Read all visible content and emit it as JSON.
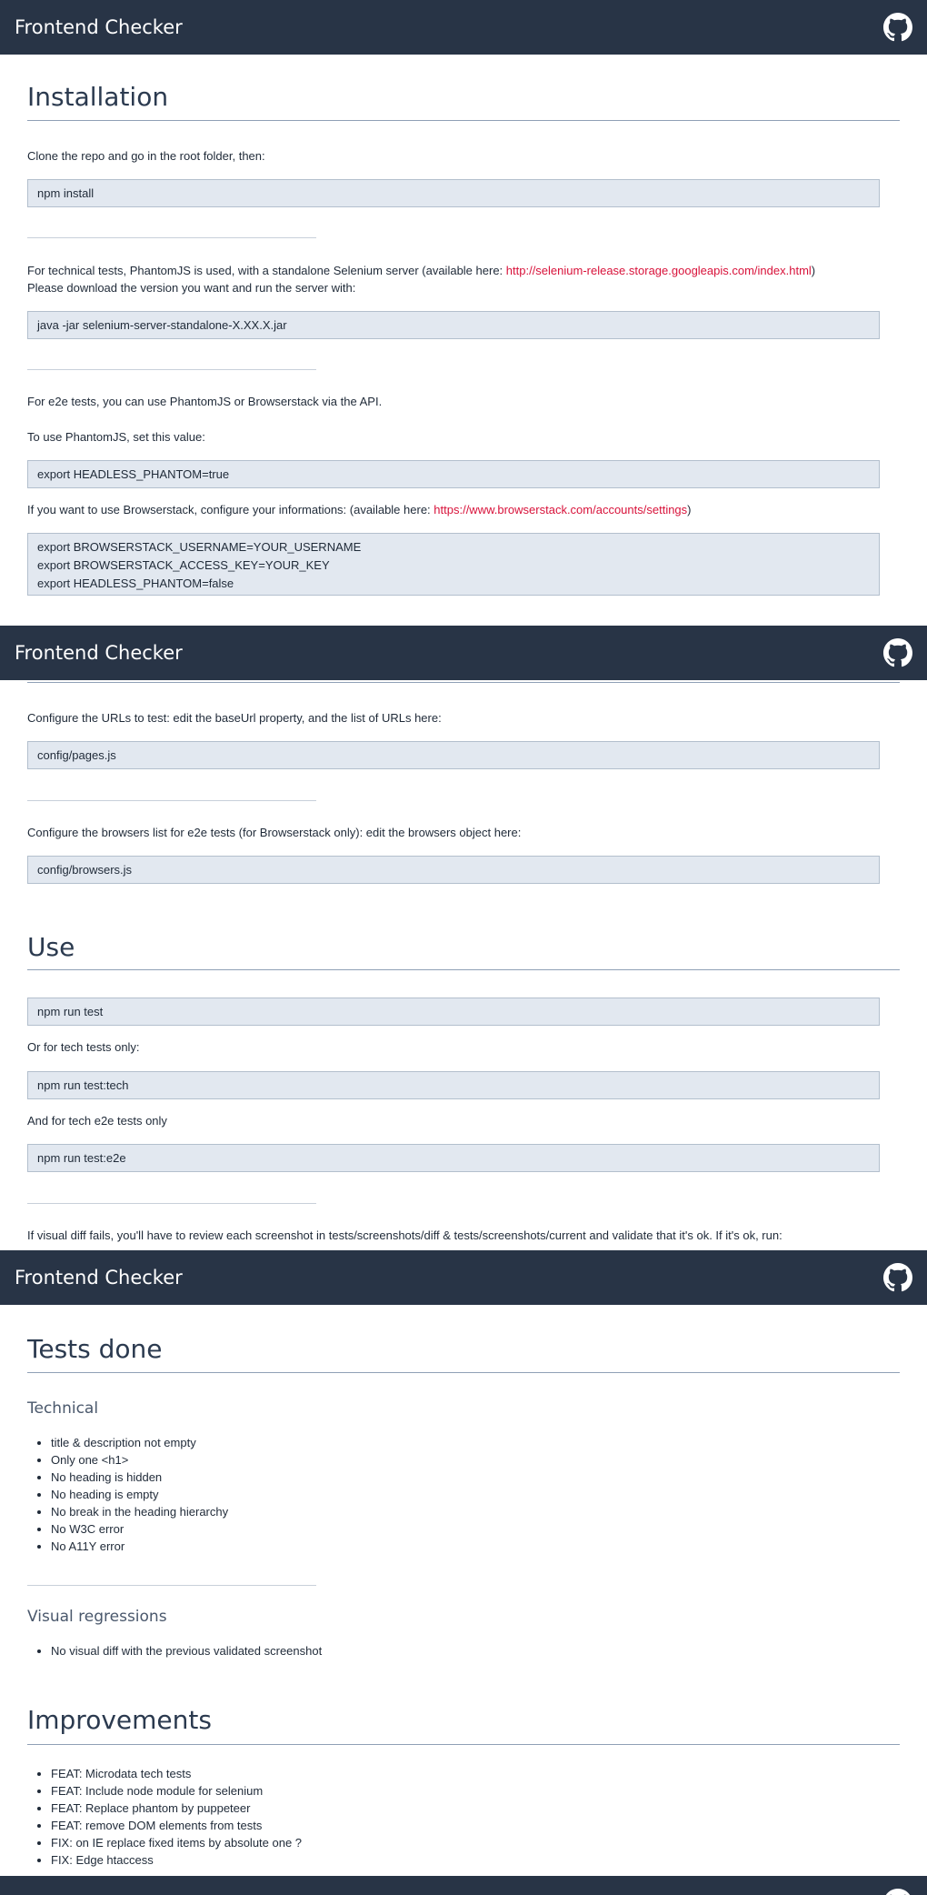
{
  "app": {
    "title": "Frontend Checker",
    "github_icon": "github-icon"
  },
  "installation": {
    "heading": "Installation",
    "clone_text": "Clone the repo and go in the root folder, then:",
    "npm_install": "npm install",
    "tech_text_before": "For technical tests, PhantomJS is used, with a standalone Selenium server (available here: ",
    "selenium_link": "http://selenium-release.storage.googleapis.com/index.html",
    "tech_text_after": ")",
    "download_text": "Please download the version you want and run the server with:",
    "java_cmd": "java -jar selenium-server-standalone-X.XX.X.jar",
    "e2e_text": "For e2e tests, you can use PhantomJS or Browserstack via the API.",
    "phantom_text": "To use PhantomJS, set this value:",
    "phantom_cmd": "export HEADLESS_PHANTOM=true",
    "bs_text_before": "If you want to use Browserstack, configure your informations: (available here: ",
    "bs_link": "https://www.browserstack.com/accounts/settings",
    "bs_text_after": ")",
    "bs_cmds": [
      "export BROWSERSTACK_USERNAME=YOUR_USERNAME",
      "export BROWSERSTACK_ACCESS_KEY=YOUR_KEY",
      "export HEADLESS_PHANTOM=false"
    ],
    "urls_text": "Configure the URLs to test: edit the baseUrl property, and the list of URLs here:",
    "pages_file": "config/pages.js",
    "browsers_text": "Configure the browsers list for e2e tests (for Browserstack only): edit the browsers object here:",
    "browsers_file": "config/browsers.js"
  },
  "use": {
    "heading": "Use",
    "cmd_test": "npm run test",
    "tech_only_text": "Or for tech tests only:",
    "cmd_tech": "npm run test:tech",
    "e2e_only_text": "And for tech e2e tests only",
    "cmd_e2e": "npm run test:e2e",
    "visual_diff_text": "If visual diff fails, you'll have to review each screenshot in tests/screenshots/diff & tests/screenshots/current and validate that it's ok. If it's ok, run:"
  },
  "tests_done": {
    "heading": "Tests done",
    "technical_heading": "Technical",
    "technical_items": [
      "title & description not empty",
      "Only one <h1>",
      "No heading is hidden",
      "No heading is empty",
      "No break in the heading hierarchy",
      "No W3C error",
      "No A11Y error"
    ],
    "visual_heading": "Visual regressions",
    "visual_items": [
      "No visual diff with the previous validated screenshot"
    ]
  },
  "improvements": {
    "heading": "Improvements",
    "items": [
      "FEAT: Microdata tech tests",
      "FEAT: Include node module for selenium",
      "FEAT: Replace phantom by puppeteer",
      "FEAT: remove DOM elements from tests",
      "FIX: on IE replace fixed items by absolute one ?",
      "FIX: Edge htaccess"
    ]
  },
  "colors": {
    "header_bg": "#283446",
    "link": "#d8123a",
    "code_bg": "#e2e8f0"
  }
}
